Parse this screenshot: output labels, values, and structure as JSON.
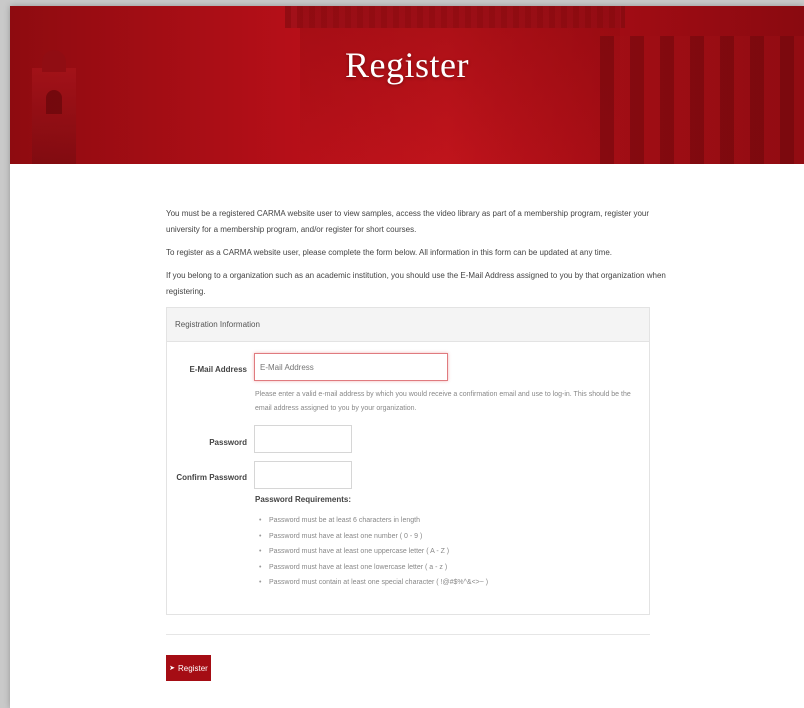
{
  "header": {
    "title": "Register"
  },
  "intro": {
    "p1": "You must be a registered CARMA website user to view samples, access the video library as part of a membership program, register your university for a membership program, and/or register for short courses.",
    "p2": "To register as a CARMA website user, please complete the form below. All information in this form can be updated at any time.",
    "p3": "If you belong to a organization such as an academic institution, you should use the E-Mail Address assigned to you by that organization when registering."
  },
  "form": {
    "panel_title": "Registration Information",
    "email": {
      "label": "E-Mail Address",
      "placeholder": "E-Mail Address",
      "value": "",
      "help": "Please enter a valid e-mail address by which you would receive a confirmation email and use to log-in. This should be the email address assigned to you by your organization."
    },
    "password": {
      "label": "Password",
      "value": ""
    },
    "confirm_password": {
      "label": "Confirm Password",
      "value": ""
    },
    "requirements": {
      "title": "Password Requirements:",
      "items": [
        "Password must be at least 6 characters in length",
        "Password must have at least one number ( 0 - 9 )",
        "Password must have at least one uppercase letter ( A - Z )",
        "Password must have at least one lowercase letter ( a - z )",
        "Password must contain at least one special character ( !@#$%^&<>~ )"
      ]
    },
    "submit": {
      "icon": "sign-in-icon",
      "label": "Register"
    }
  },
  "colors": {
    "brand_red": "#a50d14",
    "focus_border": "#e07b7f"
  }
}
